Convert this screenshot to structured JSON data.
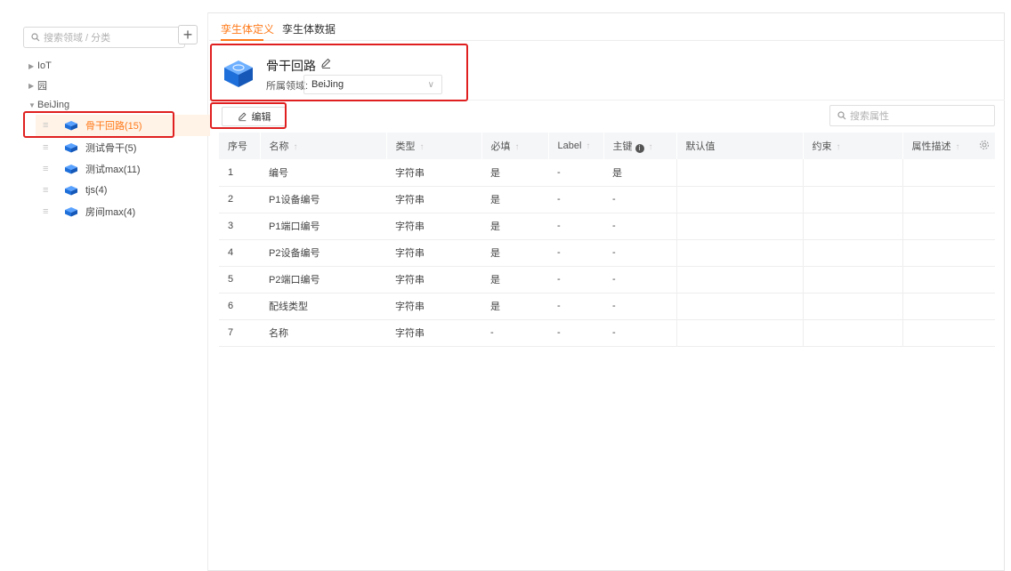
{
  "sidebar": {
    "search_placeholder": "搜索领域 / 分类",
    "add_label": "+",
    "tree": [
      {
        "label": "IoT",
        "expanded": false
      },
      {
        "label": "园",
        "expanded": false
      },
      {
        "label": "BeiJing",
        "expanded": true
      }
    ],
    "children": [
      {
        "label": "骨干回路(15)",
        "active": true
      },
      {
        "label": "测试骨干(5)",
        "active": false
      },
      {
        "label": "测试max(11)",
        "active": false
      },
      {
        "label": "tjs(4)",
        "active": false
      },
      {
        "label": "房间max(4)",
        "active": false
      }
    ]
  },
  "tabs": [
    {
      "label": "孪生体定义",
      "active": true
    },
    {
      "label": "孪生体数据",
      "active": false
    }
  ],
  "entity": {
    "name": "骨干回路",
    "domain_label": "所属领域:",
    "domain_value": "BeiJing"
  },
  "toolbar": {
    "edit_label": "编辑",
    "search_placeholder": "搜索属性"
  },
  "table": {
    "columns": [
      "序号",
      "名称",
      "类型",
      "必填",
      "Label",
      "主键",
      "默认值",
      "约束",
      "属性描述"
    ],
    "rows": [
      [
        "1",
        "编号",
        "字符串",
        "是",
        "-",
        "是",
        "",
        "",
        ""
      ],
      [
        "2",
        "P1设备编号",
        "字符串",
        "是",
        "-",
        "-",
        "",
        "",
        ""
      ],
      [
        "3",
        "P1端口编号",
        "字符串",
        "是",
        "-",
        "-",
        "",
        "",
        ""
      ],
      [
        "4",
        "P2设备编号",
        "字符串",
        "是",
        "-",
        "-",
        "",
        "",
        ""
      ],
      [
        "5",
        "P2端口编号",
        "字符串",
        "是",
        "-",
        "-",
        "",
        "",
        ""
      ],
      [
        "6",
        "配线类型",
        "字符串",
        "是",
        "-",
        "-",
        "",
        "",
        ""
      ],
      [
        "7",
        "名称",
        "字符串",
        "-",
        "-",
        "-",
        "",
        "",
        ""
      ]
    ]
  },
  "colors": {
    "accent": "#ff7a1a",
    "highlight": "#e02020",
    "cube": "#1e6fd9"
  }
}
